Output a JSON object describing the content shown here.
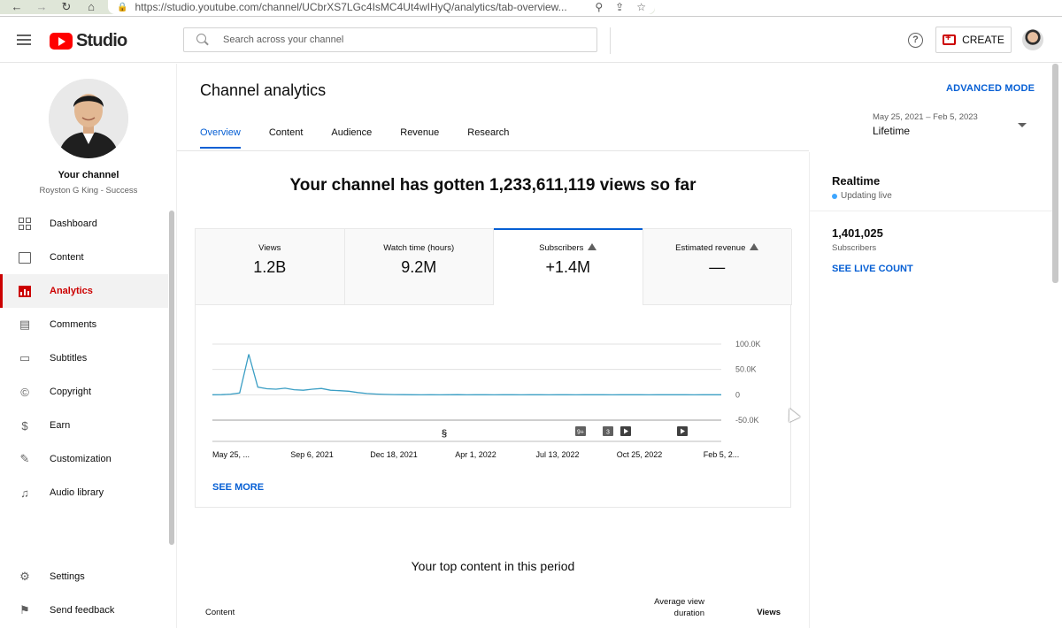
{
  "browser": {
    "url": "https://studio.youtube.com/channel/UCbrXS7LGc4IsMC4Ut4wIHyQ/analytics/tab-overview..."
  },
  "header": {
    "logo_text": "Studio",
    "search_placeholder": "Search across your channel",
    "create_label": "CREATE"
  },
  "sidebar": {
    "channel_title": "Your channel",
    "channel_name": "Royston G King - Success",
    "items": [
      {
        "label": "Dashboard",
        "icon": "dashboard-icon"
      },
      {
        "label": "Content",
        "icon": "content-icon"
      },
      {
        "label": "Analytics",
        "icon": "analytics-icon",
        "active": true
      },
      {
        "label": "Comments",
        "icon": "comments-icon"
      },
      {
        "label": "Subtitles",
        "icon": "subtitles-icon"
      },
      {
        "label": "Copyright",
        "icon": "copyright-icon"
      },
      {
        "label": "Earn",
        "icon": "earn-icon"
      },
      {
        "label": "Customization",
        "icon": "customization-icon"
      },
      {
        "label": "Audio library",
        "icon": "audio-library-icon"
      }
    ],
    "bottom_items": [
      {
        "label": "Settings",
        "icon": "gear-icon"
      },
      {
        "label": "Send feedback",
        "icon": "feedback-icon"
      }
    ]
  },
  "main": {
    "title": "Channel analytics",
    "advanced_mode": "ADVANCED MODE",
    "tabs": [
      "Overview",
      "Content",
      "Audience",
      "Revenue",
      "Research"
    ],
    "active_tab": "Overview",
    "date_range": "May 25, 2021 – Feb 5, 2023",
    "date_label": "Lifetime",
    "headline": "Your channel has gotten 1,233,611,119 views so far",
    "metrics": [
      {
        "label": "Views",
        "value": "1.2B"
      },
      {
        "label": "Watch time (hours)",
        "value": "9.2M"
      },
      {
        "label": "Subscribers",
        "value": "+1.4M",
        "warning": true,
        "active": true
      },
      {
        "label": "Estimated revenue",
        "value": "—",
        "warning": true
      }
    ],
    "see_more": "SEE MORE",
    "top_content_title": "Your top content in this period",
    "table_headers": {
      "content": "Content",
      "avg_view_duration_line1": "Average view",
      "avg_view_duration_line2": "duration",
      "views": "Views"
    }
  },
  "realtime": {
    "title": "Realtime",
    "status": "Updating live",
    "subscriber_count": "1,401,025",
    "subscriber_label": "Subscribers",
    "live_count_link": "SEE LIVE COUNT"
  },
  "colors": {
    "accent_blue": "#065fd4",
    "brand_red": "#cc0000",
    "chart_line": "#3a9ec4"
  },
  "chart_data": {
    "type": "line",
    "series": [
      {
        "values": [
          0,
          300,
          1200,
          3500,
          80000,
          15000,
          12000,
          11000,
          13000,
          10000,
          9000,
          11000,
          12500,
          9000,
          8000,
          7000,
          4500,
          2500,
          1500,
          800,
          400,
          200,
          0,
          -200,
          100,
          -100,
          0,
          150,
          -150,
          0,
          50,
          -50,
          100,
          0,
          -100,
          50,
          0,
          -50,
          0,
          100,
          -100,
          0,
          50,
          0,
          -50,
          0,
          100,
          0,
          -100,
          50,
          0,
          0,
          50,
          -50,
          0,
          100,
          0
        ]
      }
    ],
    "x_tick_labels": [
      "May 25, ...",
      "Sep 6, 2021",
      "Dec 18, 2021",
      "Apr 1, 2022",
      "Jul 13, 2022",
      "Oct 25, 2022",
      "Feb 5, 2..."
    ],
    "y_tick_labels": [
      "100.0K",
      "50.0K",
      "0",
      "-50.0K"
    ],
    "ylim": [
      -50000,
      100000
    ],
    "grid": true,
    "markers": [
      "9+",
      "3"
    ]
  }
}
